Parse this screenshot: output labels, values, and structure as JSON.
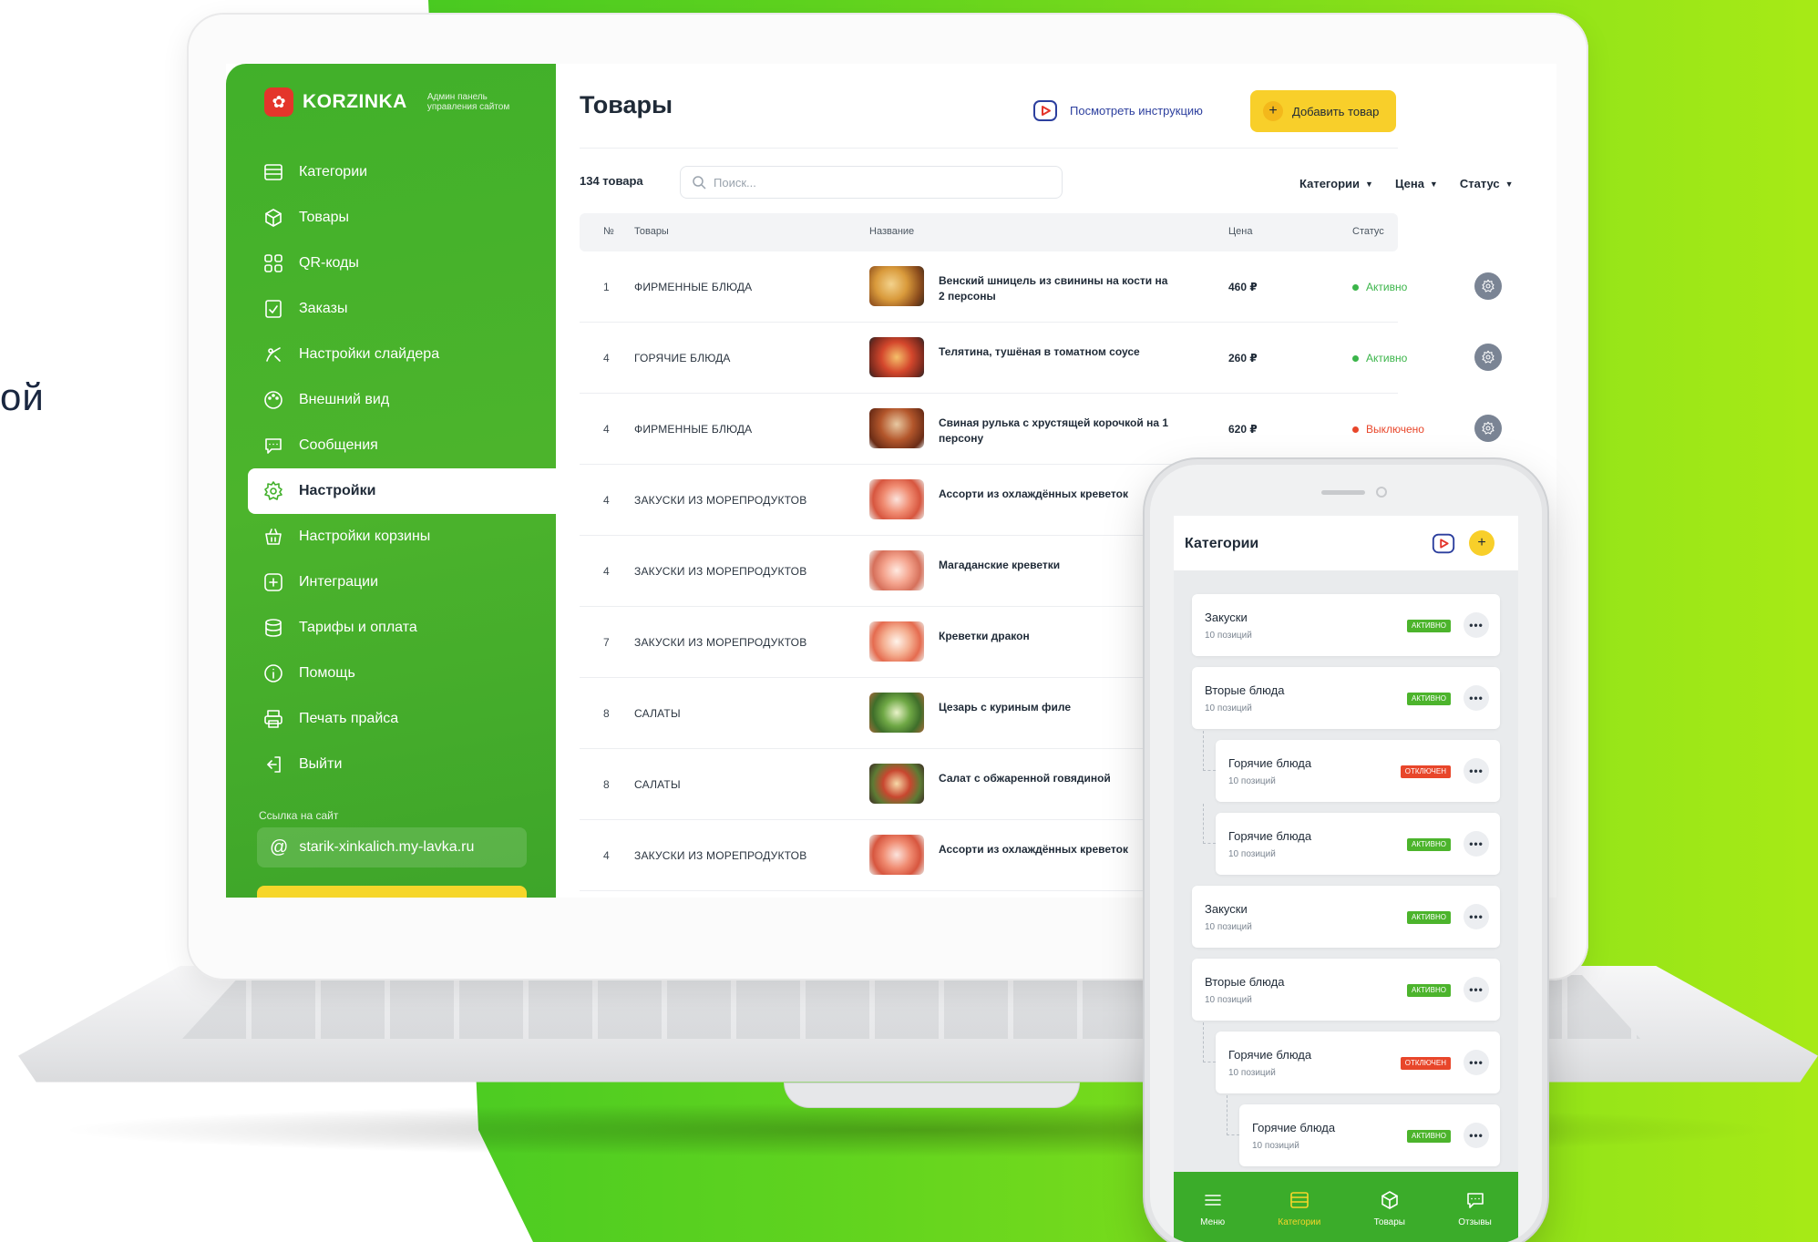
{
  "side_text": "ой",
  "colors": {
    "green": "#41b02a",
    "yellow": "#f8cf2a",
    "active_status": "#3bb54a",
    "disabled_status": "#e8462a"
  },
  "sidebar": {
    "brand_name": "KORZINKA",
    "brand_subtitle": "Админ панель управления сайтом",
    "items": [
      {
        "label": "Категории",
        "icon": "list-icon"
      },
      {
        "label": "Товары",
        "icon": "box-icon"
      },
      {
        "label": "QR-коды",
        "icon": "qr-icon"
      },
      {
        "label": "Заказы",
        "icon": "orders-icon"
      },
      {
        "label": "Настройки слайдера",
        "icon": "slider-icon"
      },
      {
        "label": "Внешний вид",
        "icon": "palette-icon"
      },
      {
        "label": "Сообщения",
        "icon": "message-icon"
      },
      {
        "label": "Настройки",
        "icon": "gear-icon"
      },
      {
        "label": "Настройки корзины",
        "icon": "basket-icon"
      },
      {
        "label": "Интеграции",
        "icon": "integration-icon"
      },
      {
        "label": "Тарифы и оплата",
        "icon": "coins-icon"
      },
      {
        "label": "Помощь",
        "icon": "info-icon"
      },
      {
        "label": "Печать прайса",
        "icon": "printer-icon"
      },
      {
        "label": "Выйти",
        "icon": "logout-icon"
      }
    ],
    "active_index": 7,
    "site_label": "Ссылка на сайт",
    "site_url": "starik-xinkalich.my-lavka.ru"
  },
  "main": {
    "title": "Товары",
    "instruction_label": "Посмотреть инструкцию",
    "add_label": "Добавить товар",
    "count": "134 товара",
    "search_placeholder": "Поиск...",
    "filters": [
      "Категории",
      "Цена",
      "Статус"
    ],
    "columns": {
      "num": "№",
      "category": "Товары",
      "name": "Название",
      "price": "Цена",
      "status": "Статус"
    },
    "rows": [
      {
        "num": "1",
        "category": "ФИРМЕННЫЕ БЛЮДА",
        "name": "Венский шницель из свинины на кости на 2 персоны",
        "price": "460 ₽",
        "status": "Активно",
        "status_type": "active"
      },
      {
        "num": "4",
        "category": "ГОРЯЧИЕ БЛЮДА",
        "name": "Телятина, тушёная в томатном соусе",
        "price": "260 ₽",
        "status": "Активно",
        "status_type": "active"
      },
      {
        "num": "4",
        "category": "ФИРМЕННЫЕ БЛЮДА",
        "name": "Свиная рулька с хрустящей корочкой на 1 персону",
        "price": "620 ₽",
        "status": "Выключено",
        "status_type": "off"
      },
      {
        "num": "4",
        "category": "ЗАКУСКИ ИЗ МОРЕПРОДУКТОВ",
        "name": "Ассорти из охлаждённых креветок",
        "price": "",
        "status": "",
        "status_type": ""
      },
      {
        "num": "4",
        "category": "ЗАКУСКИ ИЗ МОРЕПРОДУКТОВ",
        "name": "Магаданские креветки",
        "price": "",
        "status": "",
        "status_type": ""
      },
      {
        "num": "7",
        "category": "ЗАКУСКИ ИЗ МОРЕПРОДУКТОВ",
        "name": "Креветки дракон",
        "price": "",
        "status": "",
        "status_type": ""
      },
      {
        "num": "8",
        "category": "САЛАТЫ",
        "name": "Цезарь с куриным филе",
        "price": "",
        "status": "",
        "status_type": ""
      },
      {
        "num": "8",
        "category": "САЛАТЫ",
        "name": "Салат с обжаренной говядиной",
        "price": "",
        "status": "",
        "status_type": ""
      },
      {
        "num": "4",
        "category": "ЗАКУСКИ ИЗ МОРЕПРОДУКТОВ",
        "name": "Ассорти из охлаждённых креветок",
        "price": "",
        "status": "",
        "status_type": ""
      }
    ]
  },
  "phone": {
    "title": "Категории",
    "cards": [
      {
        "name": "Закуски",
        "sub": "10 позиций",
        "badge": "АКТИВНО",
        "state": "active",
        "level": 0
      },
      {
        "name": "Вторые блюда",
        "sub": "10 позиций",
        "badge": "АКТИВНО",
        "state": "active",
        "level": 0
      },
      {
        "name": "Горячие блюда",
        "sub": "10 позиций",
        "badge": "ОТКЛЮЧЕН",
        "state": "off",
        "level": 1
      },
      {
        "name": "Горячие блюда",
        "sub": "10 позиций",
        "badge": "АКТИВНО",
        "state": "active",
        "level": 1
      },
      {
        "name": "Закуски",
        "sub": "10 позиций",
        "badge": "АКТИВНО",
        "state": "active",
        "level": 0
      },
      {
        "name": "Вторые блюда",
        "sub": "10 позиций",
        "badge": "АКТИВНО",
        "state": "active",
        "level": 0
      },
      {
        "name": "Горячие блюда",
        "sub": "10 позиций",
        "badge": "ОТКЛЮЧЕН",
        "state": "off",
        "level": 1
      },
      {
        "name": "Горячие блюда",
        "sub": "10 позиций",
        "badge": "АКТИВНО",
        "state": "active",
        "level": 2
      }
    ],
    "tabs": [
      {
        "label": "Меню",
        "icon": "menu-icon"
      },
      {
        "label": "Категории",
        "icon": "list-icon"
      },
      {
        "label": "Товары",
        "icon": "box-icon"
      },
      {
        "label": "Отзывы",
        "icon": "message-icon"
      }
    ],
    "active_tab": 1
  }
}
